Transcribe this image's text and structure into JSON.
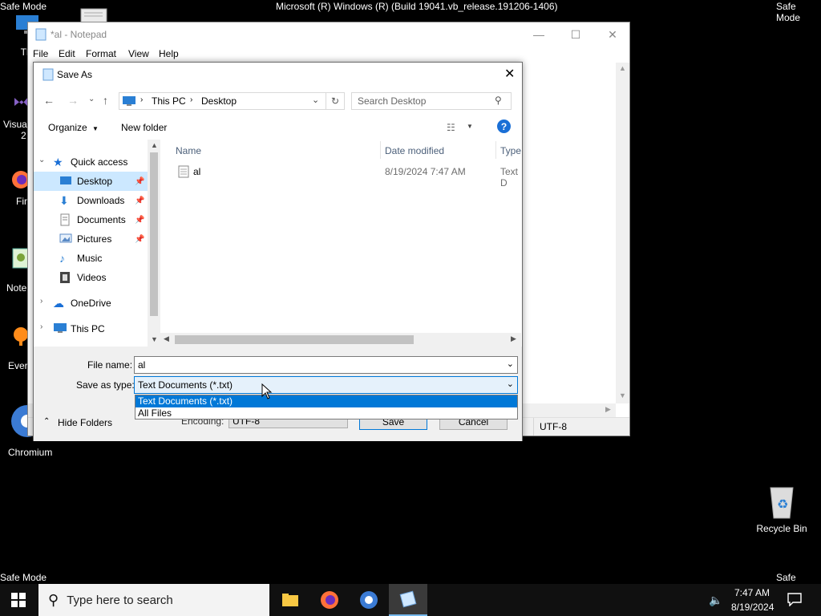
{
  "desktop": {
    "safe_mode_tl": "Safe Mode",
    "safe_mode_tr": "Safe Mode",
    "safe_mode_bl": "Safe Mode",
    "safe_mode_br": "Safe Mode",
    "build_text": "Microsoft (R) Windows (R) (Build 19041.vb_release.191206-1406)",
    "icons": {
      "thispc": "Thi",
      "visual": "Visua",
      "visual2": "2",
      "firefox": "Fir",
      "notepad": "Note",
      "everything": "Ever",
      "chromium": "Chromium",
      "recycle": "Recycle Bin"
    }
  },
  "notepad": {
    "title": "*al - Notepad",
    "menu": [
      "File",
      "Edit",
      "Format",
      "View",
      "Help"
    ],
    "status_encoding": "UTF-8"
  },
  "saveas": {
    "title": "Save As",
    "address": {
      "root": "This PC",
      "folder": "Desktop"
    },
    "search_placeholder": "Search Desktop",
    "organize": "Organize",
    "new_folder": "New folder",
    "nav": {
      "quick_access": "Quick access",
      "items": [
        "Desktop",
        "Downloads",
        "Documents",
        "Pictures",
        "Music",
        "Videos"
      ],
      "onedrive": "OneDrive",
      "thispc": "This PC"
    },
    "columns": {
      "name": "Name",
      "date": "Date modified",
      "type": "Type"
    },
    "files": [
      {
        "name": "al",
        "date": "8/19/2024 7:47 AM",
        "type": "Text D"
      }
    ],
    "file_name_label": "File name:",
    "file_name_value": "al",
    "save_type_label": "Save as type:",
    "save_type_value": "Text Documents (*.txt)",
    "save_type_options": [
      "Text Documents (*.txt)",
      "All Files"
    ],
    "encoding_label": "Encoding:",
    "encoding_value": "UTF-8",
    "save_btn": "Save",
    "cancel_btn": "Cancel",
    "hide_folders": "Hide Folders"
  },
  "taskbar": {
    "search_placeholder": "Type here to search",
    "time": "7:47 AM",
    "date": "8/19/2024"
  },
  "colors": {
    "selection": "#0078d7",
    "nav_selected": "#cce8ff",
    "taskbar": "#101010"
  }
}
